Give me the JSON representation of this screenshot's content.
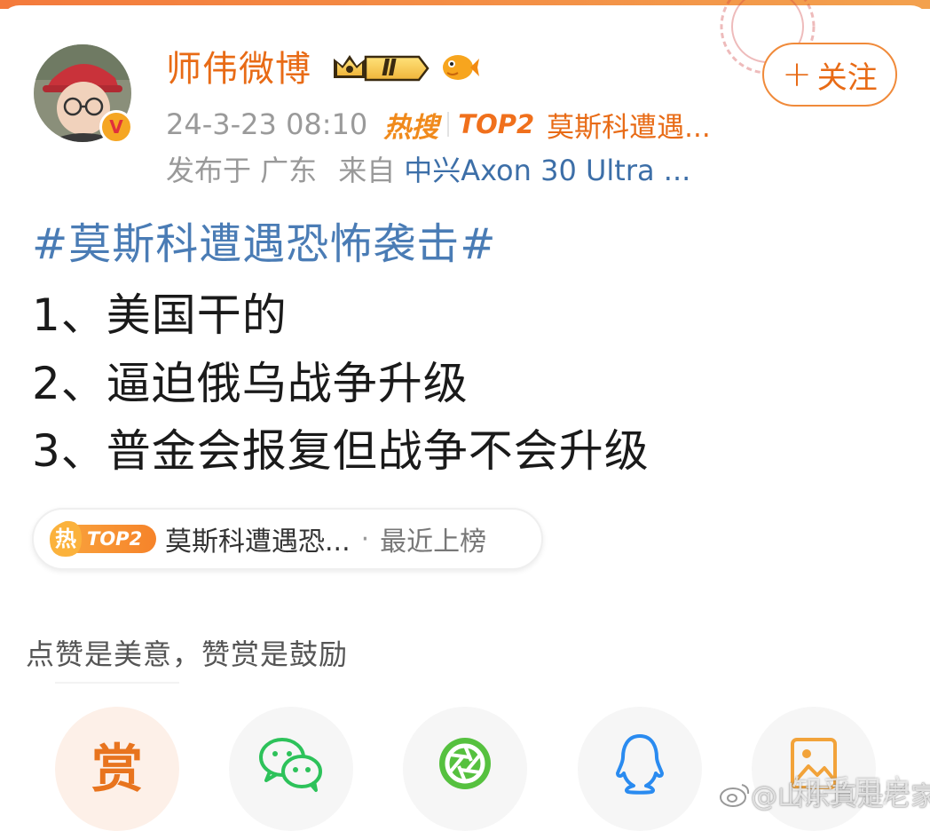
{
  "user": {
    "name": "师伟微博",
    "vip_level": "Ⅱ",
    "verified_badge": "V",
    "avatar_icon": "user-avatar",
    "follow_label": "关注",
    "follow_plus": "+"
  },
  "post_meta": {
    "time": "24-3-23 08:10",
    "hot_search_label": "热搜",
    "rank_label": "TOP2",
    "hot_title": "莫斯科遭遇...",
    "location": "发布于 广东",
    "source_prefix": "来自",
    "device": "中兴Axon 30 Ultra ..."
  },
  "post": {
    "hashtag": "#莫斯科遭遇恐怖袭击#",
    "lines": [
      "1、美国干的",
      "2、逼迫俄乌战争升级",
      "3、普金会报复但战争不会升级"
    ]
  },
  "hot_pill": {
    "icon_char": "热",
    "rank_label": "TOP2",
    "title": "莫斯科遭遇恐...",
    "separator": "·",
    "status": "最近上榜"
  },
  "reward": {
    "note": "点赞是美意，赞赏是鼓励",
    "button_char": "赏"
  },
  "share_buttons": [
    {
      "icon": "reward-icon"
    },
    {
      "icon": "wechat-icon"
    },
    {
      "icon": "moments-icon"
    },
    {
      "icon": "qq-icon"
    },
    {
      "icon": "image-icon"
    }
  ],
  "watermark": {
    "text": "@山东真是老家",
    "overlay": "知乎用户"
  },
  "colors": {
    "accent": "#e86b16",
    "link_blue": "#4a7cb5",
    "device_blue": "#3d6fa8",
    "wechat_green": "#2dc25a",
    "qq_blue": "#2a8bf0"
  }
}
